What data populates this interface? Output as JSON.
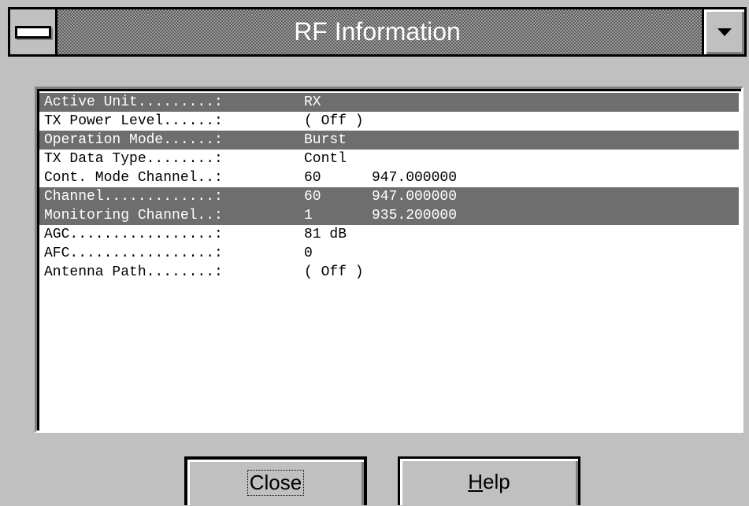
{
  "window": {
    "title": "RF Information"
  },
  "rows": [
    {
      "label": "Active Unit.........:",
      "value": "RX",
      "freq": "",
      "highlighted": true
    },
    {
      "label": "TX Power Level......:",
      "value": "( Off )",
      "freq": "",
      "highlighted": false
    },
    {
      "label": "Operation Mode......:",
      "value": "Burst",
      "freq": "",
      "highlighted": true
    },
    {
      "label": "TX Data Type........:",
      "value": "Contl",
      "freq": "",
      "highlighted": false
    },
    {
      "label": "Cont. Mode Channel..:",
      "value": "60",
      "freq": "947.000000",
      "highlighted": false
    },
    {
      "label": "Channel.............:",
      "value": "60",
      "freq": "947.000000",
      "highlighted": true
    },
    {
      "label": "Monitoring Channel..:",
      "value": "1",
      "freq": "935.200000",
      "highlighted": true
    },
    {
      "label": "AGC.................:",
      "value": "81 dB",
      "freq": "",
      "highlighted": false
    },
    {
      "label": "AFC.................:",
      "value": "0",
      "freq": "",
      "highlighted": false
    },
    {
      "label": "Antenna Path........:",
      "value": "( Off )",
      "freq": "",
      "highlighted": false
    }
  ],
  "buttons": {
    "close_label": "Close",
    "help_label_underlined": "H",
    "help_label_rest": "elp"
  },
  "icons": {
    "system_menu": "system-menu-icon",
    "dropdown": "dropdown-arrow-icon"
  },
  "colors": {
    "dialog_bg": "#c0c0c0",
    "highlight_row": "#6e6e6e",
    "title_text": "#ffffff"
  }
}
